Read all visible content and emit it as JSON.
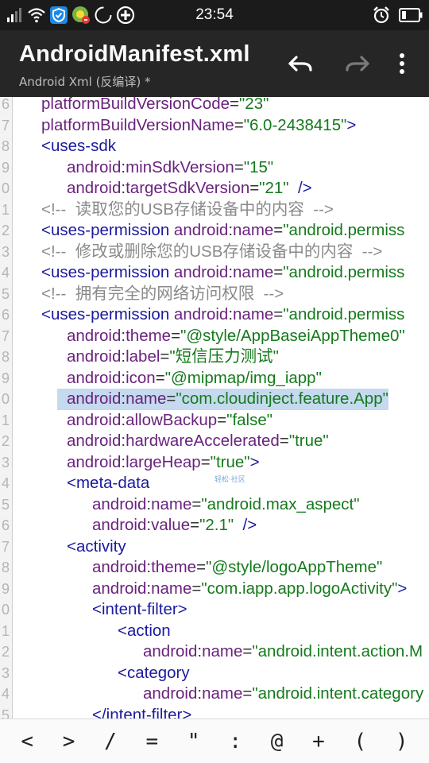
{
  "status_bar": {
    "time": "23:54",
    "icons_left": [
      "mobile-signal-icon",
      "wifi-icon",
      "shield-icon",
      "app-notification-icon",
      "loading-icon",
      "add-circle-icon"
    ],
    "icons_right": [
      "alarm-clock-icon",
      "battery-icon"
    ]
  },
  "app_bar": {
    "title": "AndroidManifest.xml",
    "subtitle": "Android Xml (反编译) *",
    "actions": [
      "undo-icon",
      "redo-icon",
      "more-vert-icon"
    ]
  },
  "editor": {
    "gutter_numbers": [
      "6",
      "7",
      "8",
      "9",
      "0",
      "1",
      "2",
      "3",
      "4",
      "5",
      "6",
      "7",
      "8",
      "9",
      "0",
      "1",
      "2",
      "3",
      "4",
      "5",
      "6",
      "7",
      "8",
      "9",
      "0",
      "1",
      "2",
      "3",
      "4",
      "5"
    ],
    "watermark": "轻松·社区",
    "lines": [
      {
        "indent": 0,
        "tokens": [
          [
            "attr",
            "platformBuildVersionCode"
          ],
          [
            "eq",
            "="
          ],
          [
            "val",
            "\"23\""
          ]
        ]
      },
      {
        "indent": 0,
        "tokens": [
          [
            "attr",
            "platformBuildVersionName"
          ],
          [
            "eq",
            "="
          ],
          [
            "val",
            "\"6.0-2438415\""
          ],
          [
            "punct",
            ">"
          ]
        ]
      },
      {
        "indent": 0,
        "tokens": [
          [
            "tag",
            "<uses-sdk"
          ]
        ]
      },
      {
        "indent": 1,
        "tokens": [
          [
            "ns",
            "android"
          ],
          [
            "eq",
            ":"
          ],
          [
            "attr",
            "minSdkVersion"
          ],
          [
            "eq",
            "="
          ],
          [
            "val",
            "\"15\""
          ]
        ]
      },
      {
        "indent": 1,
        "tokens": [
          [
            "ns",
            "android"
          ],
          [
            "eq",
            ":"
          ],
          [
            "attr",
            "targetSdkVersion"
          ],
          [
            "eq",
            "="
          ],
          [
            "val",
            "\"21\""
          ],
          [
            "punct",
            "  />"
          ]
        ]
      },
      {
        "indent": 0,
        "tokens": [
          [
            "comment",
            "<!--  读取您的USB存储设备中的内容  -->"
          ]
        ]
      },
      {
        "indent": 0,
        "tokens": [
          [
            "tag",
            "<uses-permission"
          ],
          [
            "eq",
            " "
          ],
          [
            "ns",
            "android"
          ],
          [
            "eq",
            ":"
          ],
          [
            "attr",
            "name"
          ],
          [
            "eq",
            "="
          ],
          [
            "val",
            "\"android.permiss"
          ]
        ]
      },
      {
        "indent": 0,
        "tokens": [
          [
            "comment",
            "<!--  修改或删除您的USB存储设备中的内容  -->"
          ]
        ]
      },
      {
        "indent": 0,
        "tokens": [
          [
            "tag",
            "<uses-permission"
          ],
          [
            "eq",
            " "
          ],
          [
            "ns",
            "android"
          ],
          [
            "eq",
            ":"
          ],
          [
            "attr",
            "name"
          ],
          [
            "eq",
            "="
          ],
          [
            "val",
            "\"android.permiss"
          ]
        ]
      },
      {
        "indent": 0,
        "tokens": [
          [
            "comment",
            "<!--  拥有完全的网络访问权限  -->"
          ]
        ]
      },
      {
        "indent": 0,
        "tokens": [
          [
            "tag",
            "<uses-permission"
          ],
          [
            "eq",
            " "
          ],
          [
            "ns",
            "android"
          ],
          [
            "eq",
            ":"
          ],
          [
            "attr",
            "name"
          ],
          [
            "eq",
            "="
          ],
          [
            "val",
            "\"android.permiss"
          ]
        ]
      },
      {
        "indent": 1,
        "tokens": [
          [
            "ns",
            "android"
          ],
          [
            "eq",
            ":"
          ],
          [
            "attr",
            "theme"
          ],
          [
            "eq",
            "="
          ],
          [
            "val",
            "\"@style/AppBaseiAppTheme0\""
          ]
        ]
      },
      {
        "indent": 1,
        "tokens": [
          [
            "ns",
            "android"
          ],
          [
            "eq",
            ":"
          ],
          [
            "attr",
            "label"
          ],
          [
            "eq",
            "="
          ],
          [
            "val",
            "\"短信压力测试\""
          ]
        ]
      },
      {
        "indent": 1,
        "tokens": [
          [
            "ns",
            "android"
          ],
          [
            "eq",
            ":"
          ],
          [
            "attr",
            "icon"
          ],
          [
            "eq",
            "="
          ],
          [
            "val",
            "\"@mipmap/img_iapp\""
          ]
        ]
      },
      {
        "indent": 1,
        "selected": true,
        "tokens": [
          [
            "ns",
            "android"
          ],
          [
            "eq",
            ":"
          ],
          [
            "attr",
            "name"
          ],
          [
            "eq",
            "="
          ],
          [
            "val",
            "\"com.cloudinject.feature.App\""
          ]
        ]
      },
      {
        "indent": 1,
        "tokens": [
          [
            "ns",
            "android"
          ],
          [
            "eq",
            ":"
          ],
          [
            "attr",
            "allowBackup"
          ],
          [
            "eq",
            "="
          ],
          [
            "val",
            "\"false\""
          ]
        ]
      },
      {
        "indent": 1,
        "tokens": [
          [
            "ns",
            "android"
          ],
          [
            "eq",
            ":"
          ],
          [
            "attr",
            "hardwareAccelerated"
          ],
          [
            "eq",
            "="
          ],
          [
            "val",
            "\"true\""
          ]
        ]
      },
      {
        "indent": 1,
        "tokens": [
          [
            "ns",
            "android"
          ],
          [
            "eq",
            ":"
          ],
          [
            "attr",
            "largeHeap"
          ],
          [
            "eq",
            "="
          ],
          [
            "val",
            "\"true\""
          ],
          [
            "punct",
            ">"
          ]
        ]
      },
      {
        "indent": 1,
        "tokens": [
          [
            "tag",
            "<meta-data"
          ]
        ]
      },
      {
        "indent": 2,
        "tokens": [
          [
            "ns",
            "android"
          ],
          [
            "eq",
            ":"
          ],
          [
            "attr",
            "name"
          ],
          [
            "eq",
            "="
          ],
          [
            "val",
            "\"android.max_aspect\""
          ]
        ]
      },
      {
        "indent": 2,
        "tokens": [
          [
            "ns",
            "android"
          ],
          [
            "eq",
            ":"
          ],
          [
            "attr",
            "value"
          ],
          [
            "eq",
            "="
          ],
          [
            "val",
            "\"2.1\""
          ],
          [
            "punct",
            "  />"
          ]
        ]
      },
      {
        "indent": 1,
        "tokens": [
          [
            "tag",
            "<activity"
          ]
        ]
      },
      {
        "indent": 2,
        "tokens": [
          [
            "ns",
            "android"
          ],
          [
            "eq",
            ":"
          ],
          [
            "attr",
            "theme"
          ],
          [
            "eq",
            "="
          ],
          [
            "val",
            "\"@style/logoAppTheme\""
          ]
        ]
      },
      {
        "indent": 2,
        "tokens": [
          [
            "ns",
            "android"
          ],
          [
            "eq",
            ":"
          ],
          [
            "attr",
            "name"
          ],
          [
            "eq",
            "="
          ],
          [
            "val",
            "\"com.iapp.app.logoActivity\""
          ],
          [
            "punct",
            ">"
          ]
        ]
      },
      {
        "indent": 2,
        "tokens": [
          [
            "tag",
            "<intent-filter>"
          ]
        ]
      },
      {
        "indent": 3,
        "tokens": [
          [
            "tag",
            "<action"
          ]
        ]
      },
      {
        "indent": 4,
        "tokens": [
          [
            "ns",
            "android"
          ],
          [
            "eq",
            ":"
          ],
          [
            "attr",
            "name"
          ],
          [
            "eq",
            "="
          ],
          [
            "val",
            "\"android.intent.action.M"
          ]
        ]
      },
      {
        "indent": 3,
        "tokens": [
          [
            "tag",
            "<category"
          ]
        ]
      },
      {
        "indent": 4,
        "tokens": [
          [
            "ns",
            "android"
          ],
          [
            "eq",
            ":"
          ],
          [
            "attr",
            "name"
          ],
          [
            "eq",
            "="
          ],
          [
            "val",
            "\"android.intent.category"
          ]
        ]
      },
      {
        "indent": 2,
        "tokens": [
          [
            "tag",
            "</intent-filter>"
          ]
        ]
      }
    ]
  },
  "symbol_bar": {
    "keys": [
      "<",
      ">",
      "/",
      "=",
      "\"",
      ":",
      "@",
      "+",
      "(",
      ")"
    ]
  }
}
